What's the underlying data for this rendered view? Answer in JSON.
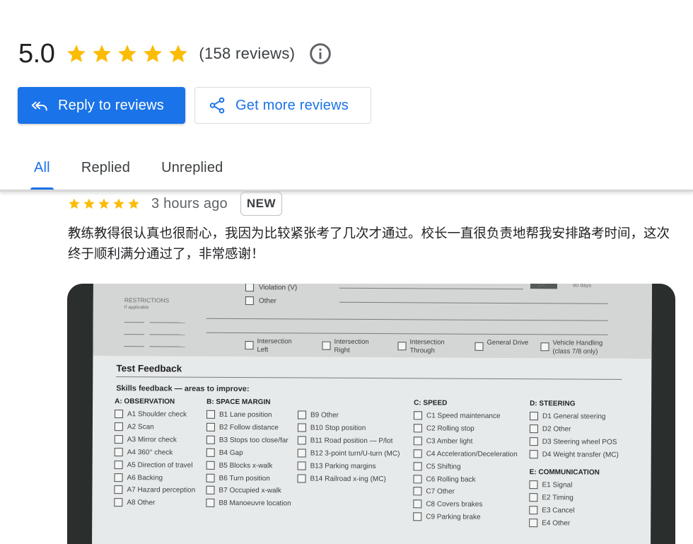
{
  "summary": {
    "rating": "5.0",
    "stars": 5,
    "review_count": "(158 reviews)",
    "star_color": "#fbbc04",
    "info_icon": "info-circle-icon"
  },
  "actions": {
    "reply": {
      "label": "Reply to reviews",
      "icon": "reply-all-icon"
    },
    "get_more": {
      "label": "Get more reviews",
      "icon": "share-icon"
    },
    "accent_color": "#1a73e8"
  },
  "tabs": [
    {
      "label": "All",
      "active": true
    },
    {
      "label": "Replied",
      "active": false
    },
    {
      "label": "Unreplied",
      "active": false
    }
  ],
  "review": {
    "stars": 5,
    "time": "3 hours ago",
    "badge": "NEW",
    "text": "教练教得很认真也很耐心，我因为比较紧张考了几次才通过。校长一直很负责地帮我安排路考时间，这次终于顺利满分通过了，非常感谢！",
    "photo": {
      "top_items": [
        "Violation (V)",
        "Other"
      ],
      "stamp": "60 days",
      "stamp_left": "3/4",
      "restrictions_label": "RESTRICTIONS",
      "restrictions_sub": "If applicable",
      "drive_options": [
        "Intersection Left",
        "Intersection Right",
        "Intersection Through",
        "General Drive",
        "Vehicle Handling (class 7/8 only)"
      ],
      "section_title": "Test Feedback",
      "skills_heading": "Skills feedback — areas to improve:",
      "observation": {
        "heading": "A: OBSERVATION",
        "items": [
          "A1 Shoulder check",
          "A2 Scan",
          "A3 Mirror check",
          "A4 360° check",
          "A5 Direction of travel",
          "A6 Backing",
          "A7 Hazard perception",
          "A8 Other"
        ]
      },
      "space_margin": {
        "heading": "B: SPACE MARGIN",
        "items": [
          "B1 Lane position",
          "B2 Follow distance",
          "B3 Stops too close/far",
          "B4 Gap",
          "B5 Blocks x-walk",
          "B6 Turn position",
          "B7 Occupied x-walk",
          "B8 Manoeuvre location"
        ],
        "items2": [
          "B9 Other",
          "B10 Stop position",
          "B11 Road position — P/lot",
          "B12 3-point turn/U-turn (MC)",
          "B13 Parking margins",
          "B14 Railroad x-ing (MC)"
        ]
      },
      "speed": {
        "heading": "C: SPEED",
        "items": [
          "C1 Speed maintenance",
          "C2 Rolling stop",
          "C3 Amber light",
          "C4 Acceleration/Deceleration",
          "C5 Shifting",
          "C6 Rolling back",
          "C7 Other",
          "C8 Covers brakes",
          "C9 Parking brake"
        ]
      },
      "steering": {
        "heading": "D: STEERING",
        "items": [
          "D1 General steering",
          "D2 Other",
          "D3 Steering wheel POS",
          "D4 Weight transfer (MC)"
        ]
      },
      "communication": {
        "heading": "E: COMMUNICATION",
        "items": [
          "E1 Signal",
          "E2 Timing",
          "E3 Cancel",
          "E4 Other"
        ]
      }
    }
  }
}
